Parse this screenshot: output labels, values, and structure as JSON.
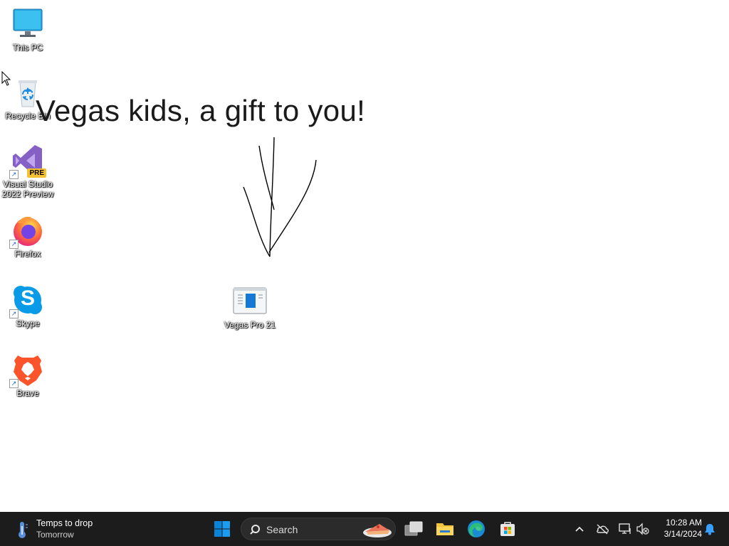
{
  "desktop": {
    "icons": [
      {
        "label": "This PC"
      },
      {
        "label": "Recycle Bin"
      },
      {
        "label": "Visual Studio 2022 Preview",
        "badge": "PRE"
      },
      {
        "label": "Firefox"
      },
      {
        "label": "Skype",
        "letter": "S"
      },
      {
        "label": "Brave"
      },
      {
        "label": "Vegas Pro 21"
      }
    ],
    "banner_text": "Vegas kids, a gift to you!"
  },
  "taskbar": {
    "weather": {
      "headline": "Temps to drop",
      "subline": "Tomorrow"
    },
    "search": {
      "placeholder": "Search"
    },
    "clock": {
      "time": "10:28 AM",
      "date": "3/14/2024"
    }
  },
  "colors": {
    "taskbar_bg": "#1c1c1c",
    "windows_blue": "#0a84d8",
    "edge_green": "#2bbf7a",
    "folder_yellow": "#f3c43c",
    "skype_blue": "#0a9be8",
    "brave_orange": "#fb542b",
    "vs_purple": "#8661c5",
    "firefox_orange": "#ff7139"
  }
}
